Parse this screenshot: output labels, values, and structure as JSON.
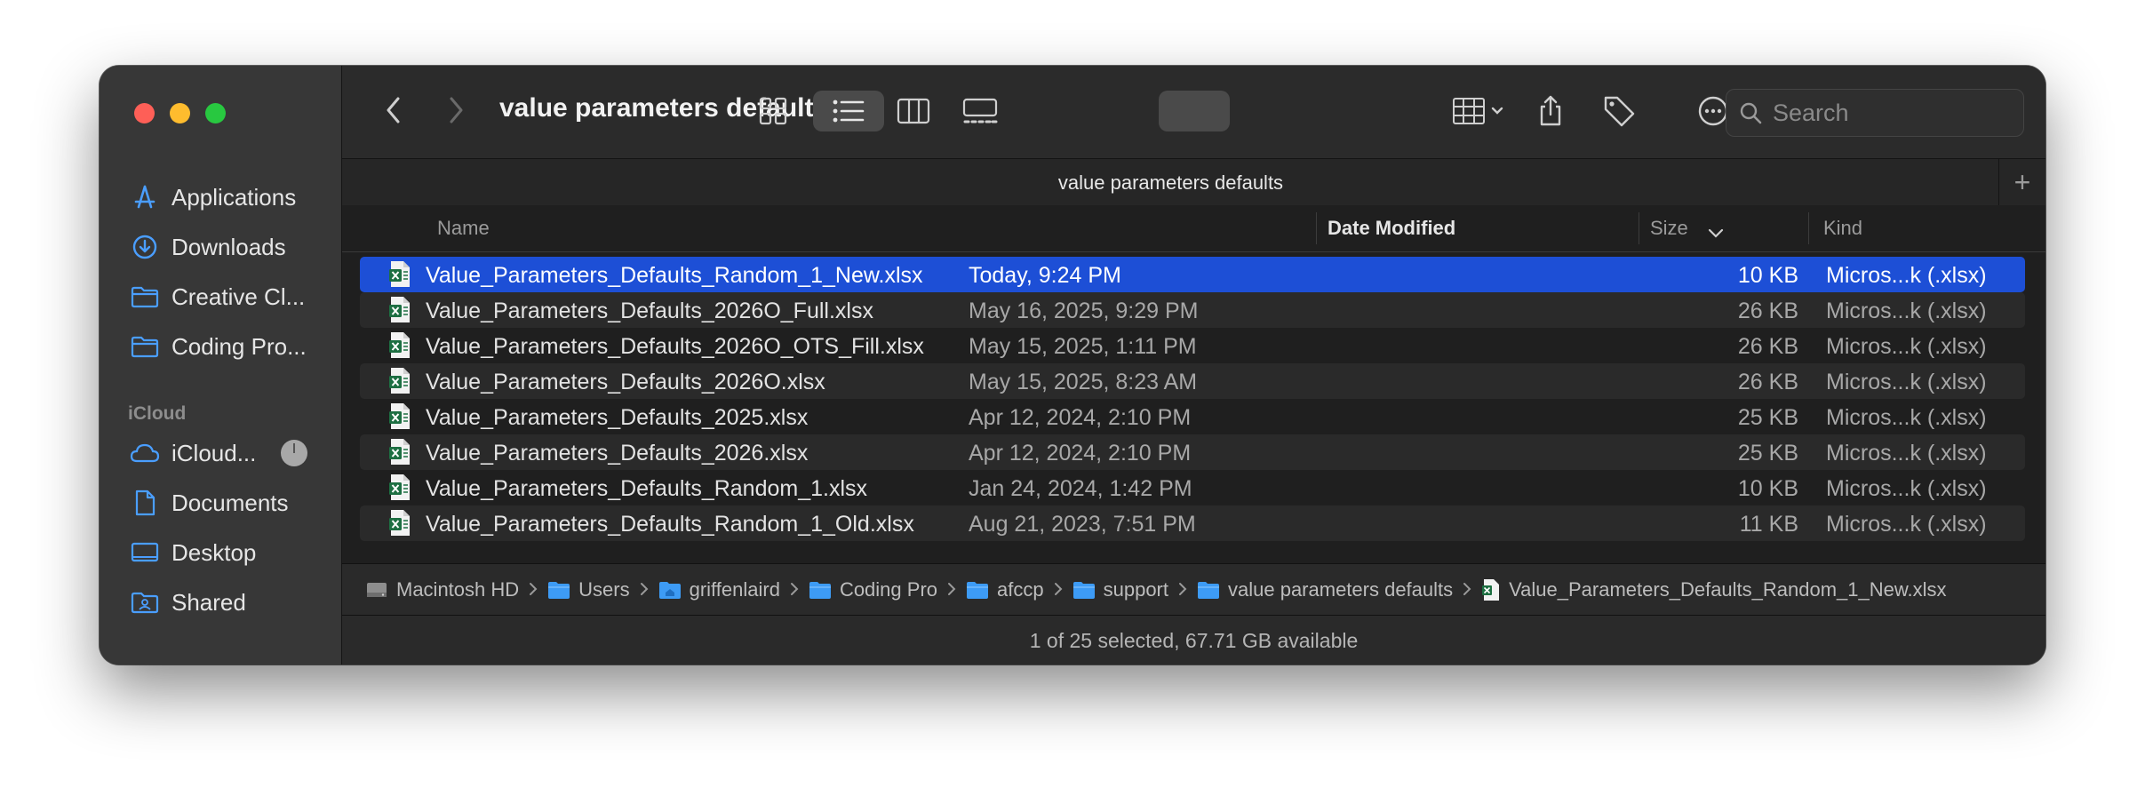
{
  "window": {
    "title": "value parameters defaults"
  },
  "sidebar": {
    "favorites": [
      {
        "label": "Applications",
        "icon": "applications-icon"
      },
      {
        "label": "Downloads",
        "icon": "downloads-icon"
      },
      {
        "label": "Creative Cl...",
        "icon": "folder-icon"
      },
      {
        "label": "Coding Pro...",
        "icon": "folder-icon"
      }
    ],
    "icloud_section": "iCloud",
    "icloud": [
      {
        "label": "iCloud...",
        "icon": "cloud-icon"
      },
      {
        "label": "Documents",
        "icon": "document-icon"
      },
      {
        "label": "Desktop",
        "icon": "desktop-icon"
      },
      {
        "label": "Shared",
        "icon": "shared-folder-icon"
      }
    ]
  },
  "toolbar": {
    "title": "value parameters defaults",
    "search_placeholder": "Search",
    "active_view": "list"
  },
  "tabbar": {
    "title": "value parameters defaults",
    "add": "+"
  },
  "columns": {
    "name": "Name",
    "date": "Date Modified",
    "size": "Size",
    "kind": "Kind"
  },
  "files": [
    {
      "name": "Value_Parameters_Defaults_Random_1_New.xlsx",
      "date": "Today, 9:24 PM",
      "size": "10 KB",
      "kind": "Micros...k (.xlsx)",
      "selected": true
    },
    {
      "name": "Value_Parameters_Defaults_2026O_Full.xlsx",
      "date": "May 16, 2025, 9:29 PM",
      "size": "26 KB",
      "kind": "Micros...k (.xlsx)"
    },
    {
      "name": "Value_Parameters_Defaults_2026O_OTS_Fill.xlsx",
      "date": "May 15, 2025, 1:11 PM",
      "size": "26 KB",
      "kind": "Micros...k (.xlsx)"
    },
    {
      "name": "Value_Parameters_Defaults_2026O.xlsx",
      "date": "May 15, 2025, 8:23 AM",
      "size": "26 KB",
      "kind": "Micros...k (.xlsx)"
    },
    {
      "name": "Value_Parameters_Defaults_2025.xlsx",
      "date": "Apr 12, 2024, 2:10 PM",
      "size": "25 KB",
      "kind": "Micros...k (.xlsx)"
    },
    {
      "name": "Value_Parameters_Defaults_2026.xlsx",
      "date": "Apr 12, 2024, 2:10 PM",
      "size": "25 KB",
      "kind": "Micros...k (.xlsx)"
    },
    {
      "name": "Value_Parameters_Defaults_Random_1.xlsx",
      "date": "Jan 24, 2024, 1:42 PM",
      "size": "10 KB",
      "kind": "Micros...k (.xlsx)"
    },
    {
      "name": "Value_Parameters_Defaults_Random_1_Old.xlsx",
      "date": "Aug 21, 2023, 7:51 PM",
      "size": "11 KB",
      "kind": "Micros...k (.xlsx)"
    }
  ],
  "pathbar": [
    {
      "label": "Macintosh HD",
      "icon": "hard-drive-icon"
    },
    {
      "label": "Users",
      "icon": "folder-icon"
    },
    {
      "label": "griffenlaird",
      "icon": "home-folder-icon"
    },
    {
      "label": "Coding Pro",
      "icon": "folder-icon"
    },
    {
      "label": "afccp",
      "icon": "folder-icon"
    },
    {
      "label": "support",
      "icon": "folder-icon"
    },
    {
      "label": "value parameters defaults",
      "icon": "folder-icon"
    },
    {
      "label": "Value_Parameters_Defaults_Random_1_New.xlsx",
      "icon": "excel-file-icon"
    }
  ],
  "status": {
    "text": "1 of 25 selected, 67.71 GB available"
  },
  "colors": {
    "selection": "#1d4fd6",
    "accent": "#4a9eff",
    "excel_green": "#1d6f42"
  }
}
